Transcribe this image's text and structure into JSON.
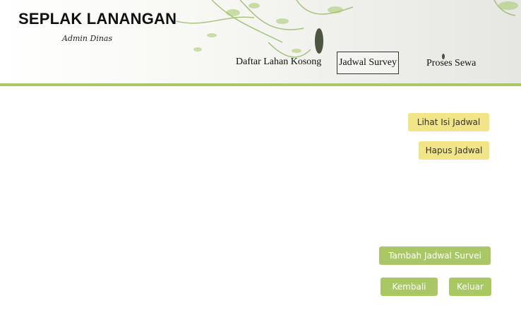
{
  "header": {
    "title": "SEPLAK LANANGAN",
    "subtitle": "Admin Dinas",
    "accent_color": "#a9c765"
  },
  "nav": {
    "items": [
      {
        "label": "Daftar Lahan Kosong",
        "active": false
      },
      {
        "label": "Jadwal Survey",
        "active": true
      },
      {
        "label": "Proses Sewa",
        "active": false
      }
    ]
  },
  "actions": {
    "view_schedule": "Lihat Isi Jadwal",
    "delete_schedule": "Hapus Jadwal",
    "add_survey_schedule": "Tambah Jadwal Survei",
    "back": "Kembali",
    "logout": "Keluar"
  },
  "colors": {
    "yellow_button": "#f2e588",
    "green_button": "#a9c765"
  }
}
